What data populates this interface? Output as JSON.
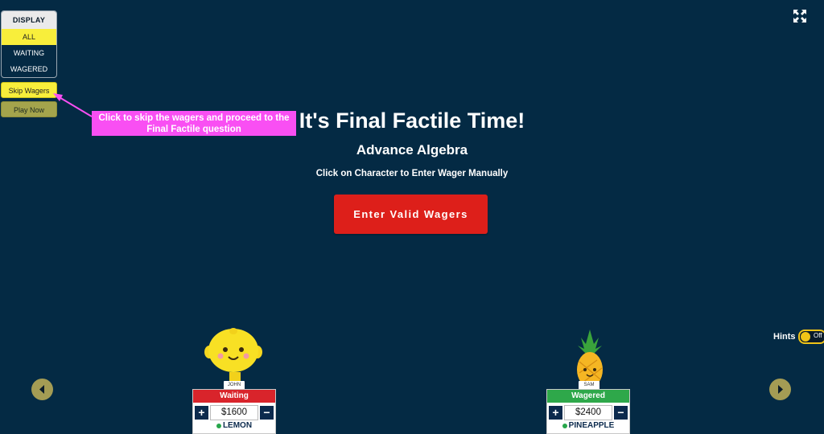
{
  "display_panel": {
    "header": "DISPLAY",
    "options": [
      "ALL",
      "WAITING",
      "WAGERED"
    ],
    "selected": "ALL"
  },
  "side_buttons": {
    "skip": "Skip Wagers",
    "play": "Play Now"
  },
  "main": {
    "title": "It's Final Factile Time!",
    "subtitle": "Advance Algebra",
    "instruction": "Click on Character to Enter Wager Manually",
    "action_button": "Enter Valid Wagers"
  },
  "callout": {
    "line1": "Click to skip the wagers and proceed to the",
    "line2": "Final Factile question"
  },
  "hints": {
    "label": "Hints",
    "state": "Off"
  },
  "players": [
    {
      "tag": "JOHN",
      "status": "Waiting",
      "amount": "$1600",
      "character": "LEMON",
      "status_color": "#d9242b"
    },
    {
      "tag": "SAM",
      "status": "Wagered",
      "amount": "$2400",
      "character": "PINEAPPLE",
      "status_color": "#2ea84a"
    }
  ],
  "colors": {
    "background": "#042a44",
    "accent_yellow": "#f8ee3b",
    "action_red": "#dd1f1a",
    "callout_pink": "#f94ff3"
  },
  "icons": [
    "fullscreen-icon",
    "plus-icon",
    "minus-icon",
    "chevron-left-icon",
    "chevron-right-icon"
  ]
}
